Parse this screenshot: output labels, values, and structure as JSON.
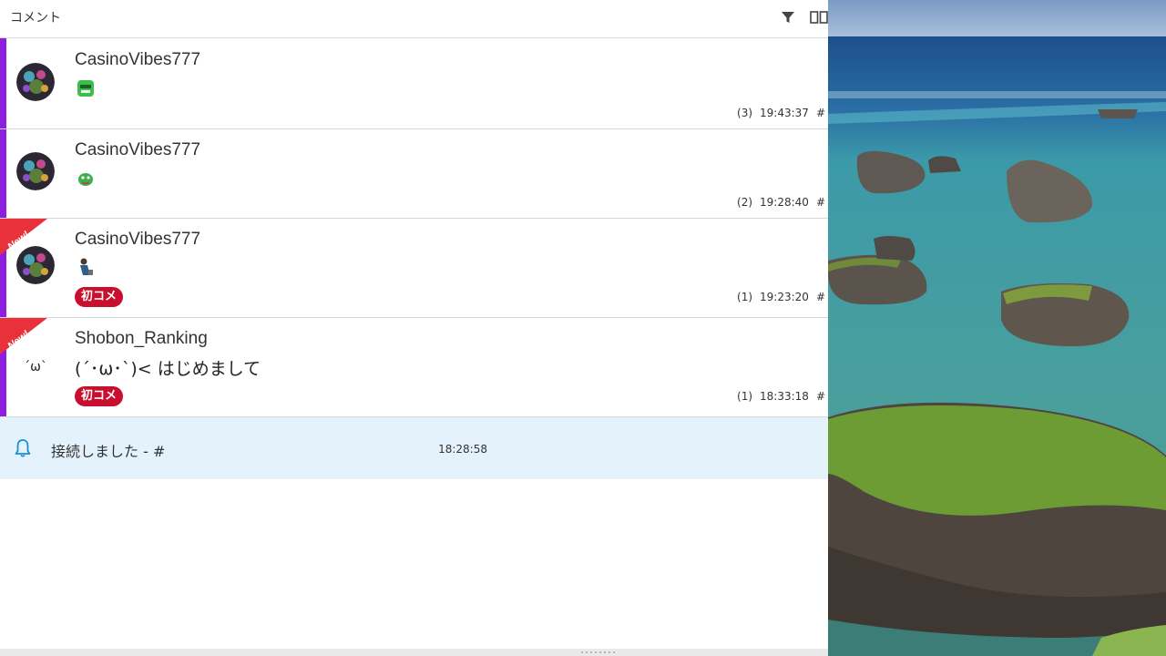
{
  "header": {
    "title": "コメント",
    "filter_icon": "filter-icon",
    "columns_icon": "columns-icon"
  },
  "comments": [
    {
      "user": "CasinoVibes777",
      "stamp": "green-monster-stamp",
      "count": "(3)",
      "time": "19:43:37",
      "hash": "#",
      "is_new": false,
      "badge": ""
    },
    {
      "user": "CasinoVibes777",
      "stamp": "green-creature-stamp",
      "count": "(2)",
      "time": "19:28:40",
      "hash": "#",
      "is_new": false,
      "badge": ""
    },
    {
      "user": "CasinoVibes777",
      "stamp": "person-stamp",
      "count": "(1)",
      "time": "19:23:20",
      "hash": "#",
      "is_new": true,
      "new_label": "New!",
      "badge": "初コメ"
    },
    {
      "user": "Shobon_Ranking",
      "avatar_text": "´ω`",
      "text": "(´･ω･`)< はじめまして",
      "count": "(1)",
      "time": "18:33:18",
      "hash": "#",
      "is_new": true,
      "new_label": "New!",
      "badge": "初コメ"
    }
  ],
  "notice": {
    "icon": "bell-icon",
    "text": "接続しました - #",
    "time": "18:28:58"
  },
  "colors": {
    "accent": "#8f1fe0",
    "badge": "#c8102e",
    "notice_bg": "#e4f3fb",
    "new_ribbon": "#e8313b"
  }
}
